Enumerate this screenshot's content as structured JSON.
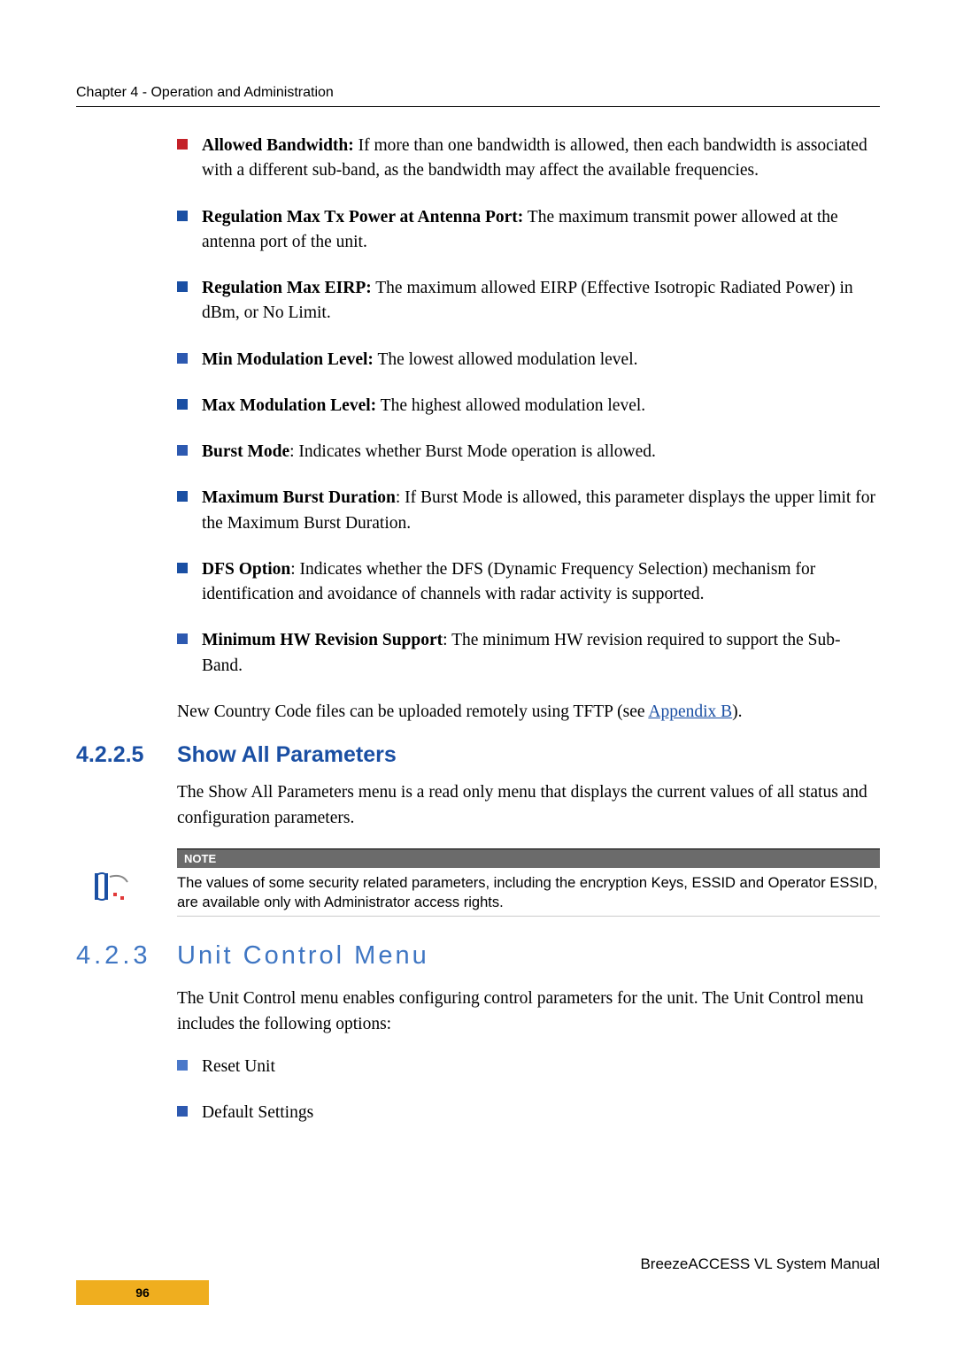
{
  "header": {
    "chapter": "Chapter 4 - Operation and Administration"
  },
  "bullets": [
    {
      "term": "Allowed Bandwidth:",
      "text": " If more than one bandwidth is allowed, then each bandwidth is associated with a different sub-band, as the bandwidth may affect the available frequencies."
    },
    {
      "term": "Regulation Max Tx Power at Antenna Port:",
      "text": " The maximum transmit power allowed at the antenna port of the unit."
    },
    {
      "term": "Regulation Max EIRP:",
      "text": " The maximum allowed EIRP (Effective Isotropic Radiated Power) in dBm, or No Limit."
    },
    {
      "term": "Min Modulation Level:",
      "text": " The lowest allowed modulation level."
    },
    {
      "term": "Max Modulation Level:",
      "text": " The highest allowed modulation level."
    },
    {
      "term": "Burst Mode",
      "text": ": Indicates whether Burst Mode operation is allowed."
    },
    {
      "term": "Maximum Burst Duration",
      "text": ": If Burst Mode is allowed, this parameter displays the upper limit for the Maximum Burst Duration."
    },
    {
      "term": "DFS Option",
      "text": ": Indicates whether the DFS (Dynamic Frequency Selection) mechanism for identification and avoidance of channels with radar activity is supported."
    },
    {
      "term": "Minimum HW Revision Support",
      "text": ": The minimum HW revision required to support the Sub-Band."
    }
  ],
  "tftp_para_pre": "New Country Code files can be uploaded remotely using TFTP (see ",
  "tftp_link": "Appendix B",
  "tftp_para_post": ").",
  "section_4225": {
    "num": "4.2.2.5",
    "title": "Show All Parameters",
    "body": "The Show All Parameters menu is a read only menu that displays the current values of all status and configuration parameters."
  },
  "note": {
    "label": "NOTE",
    "body": "The values of some security related parameters, including the encryption Keys, ESSID and Operator ESSID, are available only with Administrator access rights."
  },
  "section_423": {
    "num": "4.2.3",
    "title": "Unit Control Menu",
    "body": "The Unit Control menu enables configuring control parameters for the unit. The Unit Control menu includes the following options:"
  },
  "ucm_items": [
    "Reset Unit",
    "Default Settings"
  ],
  "footer": {
    "product": "BreezeACCESS VL System Manual",
    "page": "96"
  }
}
